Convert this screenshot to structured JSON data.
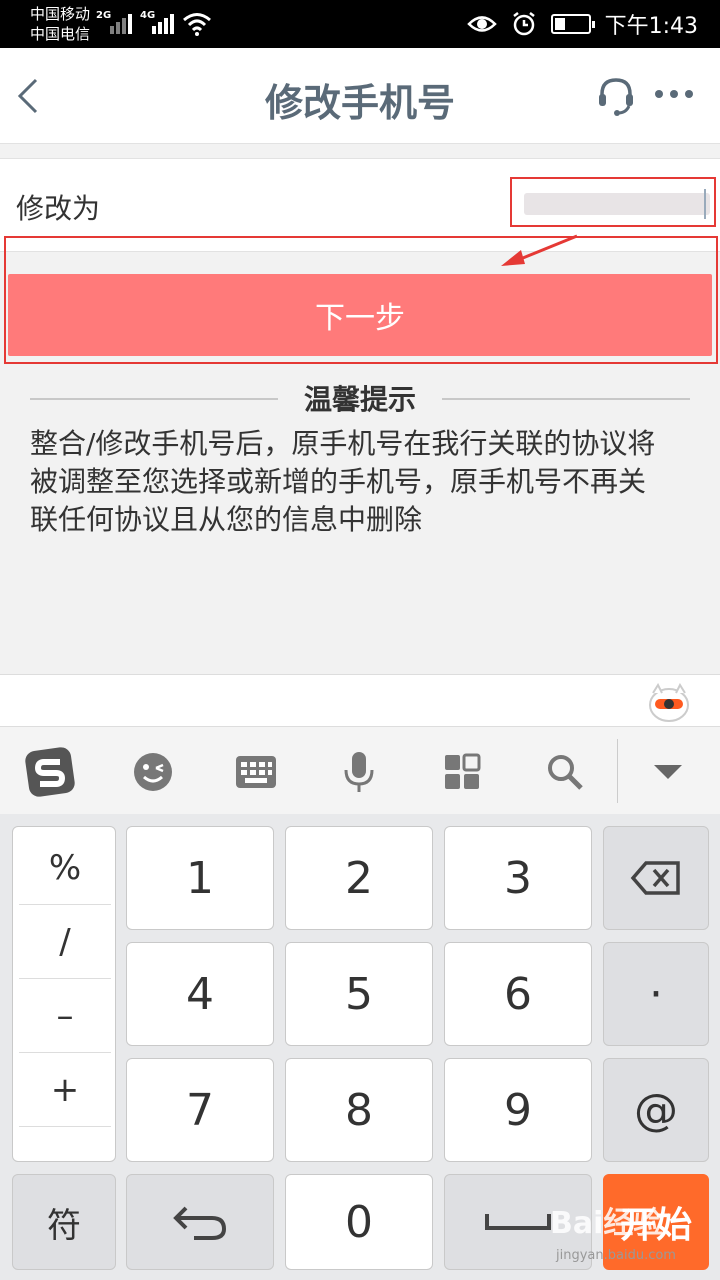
{
  "status_bar": {
    "carrier1": "中国移动",
    "carrier2": "中国电信",
    "net1": "2G",
    "net2": "4G",
    "time": "下午1:43",
    "icons": [
      "eye-icon",
      "alarm-icon",
      "battery-icon",
      "wifi-icon",
      "signal-icon"
    ]
  },
  "header": {
    "title": "修改手机号",
    "icons": [
      "back-icon",
      "headset-icon",
      "more-icon"
    ]
  },
  "form": {
    "label": "修改为",
    "input_value": ""
  },
  "next_button": {
    "label": "下一步"
  },
  "colors": {
    "primary_button": "#ff7a7a",
    "annotation": "#e53935",
    "start_key": "#ff6a2a"
  },
  "tips": {
    "title": "温馨提示",
    "lines": [
      "整合/修改手机号后，原手机号在我行关联的协议将",
      "被调整至您选择或新增的手机号，原手机号不再关",
      "联任何协议且从您的信息中删除"
    ]
  },
  "keyboard": {
    "toolbar_icons": [
      "sogou-logo-icon",
      "emoji-icon",
      "keyboard-icon",
      "mic-icon",
      "apps-icon",
      "search-icon",
      "collapse-icon"
    ],
    "symbols": [
      "%",
      "/",
      "–",
      "+"
    ],
    "digits": [
      "1",
      "2",
      "3",
      "4",
      "5",
      "6",
      "7",
      "8",
      "9",
      "0"
    ],
    "dot": "·",
    "at": "@",
    "fu": "符",
    "start": "开始"
  },
  "watermark": {
    "text": "Bai经验",
    "sub": "jingyan.baidu.com"
  }
}
